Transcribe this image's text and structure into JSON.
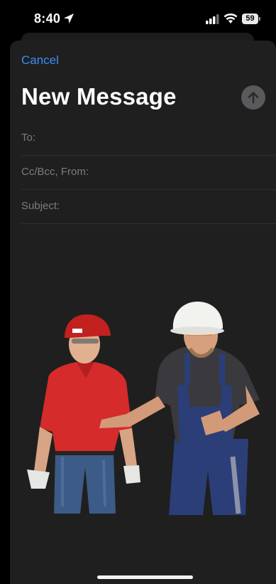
{
  "status_bar": {
    "time": "8:40",
    "battery": "59",
    "icons": [
      "location-arrow-icon",
      "cellular-signal-icon",
      "wifi-icon",
      "battery-icon"
    ]
  },
  "compose": {
    "cancel_label": "Cancel",
    "title": "New Message",
    "send_icon": "arrow-up-icon",
    "fields": {
      "to_label": "To:",
      "cc_bcc_from_label": "Cc/Bcc, From:",
      "subject_label": "Subject:"
    },
    "attachment": {
      "type": "image",
      "description": "photo"
    }
  },
  "colors": {
    "accent": "#3a8ef6",
    "sheet_bg": "#1f1f1f",
    "label_gray": "#7d7d80",
    "send_button_bg": "#5a5a5c"
  }
}
